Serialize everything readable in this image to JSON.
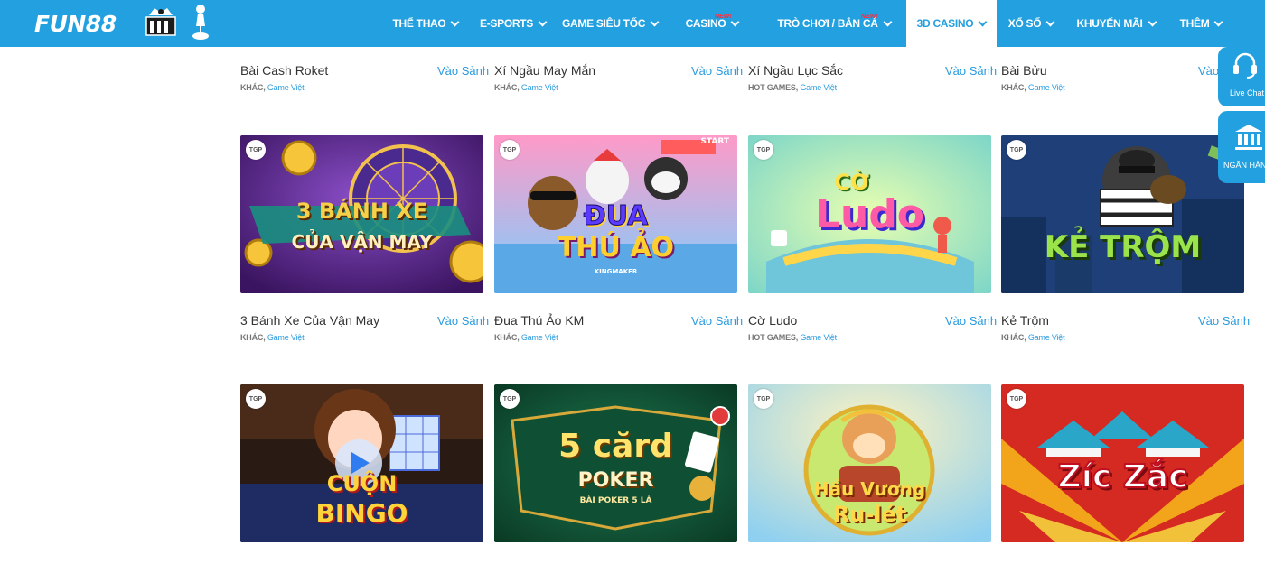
{
  "brand": {
    "logo_text": "FUN88",
    "primary_color": "#23a0df",
    "link_color": "#2b9bde"
  },
  "nav": {
    "items": [
      {
        "label": "THỂ THAO",
        "has_dropdown": true
      },
      {
        "label": "E-SPORTS",
        "has_dropdown": true
      },
      {
        "label": "GAME SIÊU TỐC",
        "has_dropdown": true
      },
      {
        "label": "CASINO",
        "badge": "NEW!",
        "has_dropdown": true
      },
      {
        "label": "TRÒ CHƠI / BẮN CÁ",
        "badge": "NEW!",
        "has_dropdown": true
      },
      {
        "label": "3D CASINO",
        "has_dropdown": true,
        "active": true
      },
      {
        "label": "XỔ SỐ",
        "has_dropdown": true
      },
      {
        "label": "KHUYẾN MÃI",
        "has_dropdown": true
      },
      {
        "label": "THÊM",
        "has_dropdown": true
      }
    ]
  },
  "games": {
    "cta_label": "Vào Sảnh",
    "row1": [
      {
        "name": "Bài Cash Roket",
        "category": "KHÁC,",
        "provider": "Game Việt"
      },
      {
        "name": "Xí Ngầu May Mắn",
        "category": "KHÁC,",
        "provider": "Game Việt"
      },
      {
        "name": "Xí Ngầu Lục Sắc",
        "category": "HOT GAMES,",
        "provider": "Game Việt"
      },
      {
        "name": "Bài Bửu",
        "category": "KHÁC,",
        "provider": "Game Việt"
      }
    ],
    "row2": [
      {
        "name": "3 Bánh Xe Của Vận May",
        "category": "KHÁC,",
        "provider": "Game Việt",
        "badge": "TGP",
        "art_title_1": "3 BÁNH XE",
        "art_title_2": "CỦA VẬN MAY"
      },
      {
        "name": "Đua Thú Ảo KM",
        "category": "KHÁC,",
        "provider": "Game Việt",
        "badge": "TGP",
        "art_title_1": "ĐUA",
        "art_title_2": "THÚ ẢO",
        "art_sub": "KINGMAKER",
        "art_extra": "START"
      },
      {
        "name": "Cờ Ludo",
        "category": "HOT GAMES,",
        "provider": "Game Việt",
        "badge": "TGP",
        "art_title_1": "CỜ",
        "art_title_2": "Ludo"
      },
      {
        "name": "Kẻ Trộm",
        "category": "KHÁC,",
        "provider": "Game Việt",
        "badge": "TGP",
        "art_title_1": "KẺ TRỘM"
      }
    ],
    "row3": [
      {
        "badge": "TGP",
        "art_title_1": "CUỘN",
        "art_title_2": "BINGO"
      },
      {
        "badge": "TGP",
        "art_title_1": "5 cărd",
        "art_title_2": "POKER",
        "art_sub": "BÀI POKER 5 LÁ"
      },
      {
        "badge": "TGP",
        "art_title_1": "Hầu Vương",
        "art_title_2": "Ru-lét"
      },
      {
        "badge": "TGP",
        "art_title_1": "Zíc Zắc"
      }
    ]
  },
  "side_tabs": {
    "live_chat": "Live Chat",
    "bank": "NGÂN HÀNG"
  }
}
